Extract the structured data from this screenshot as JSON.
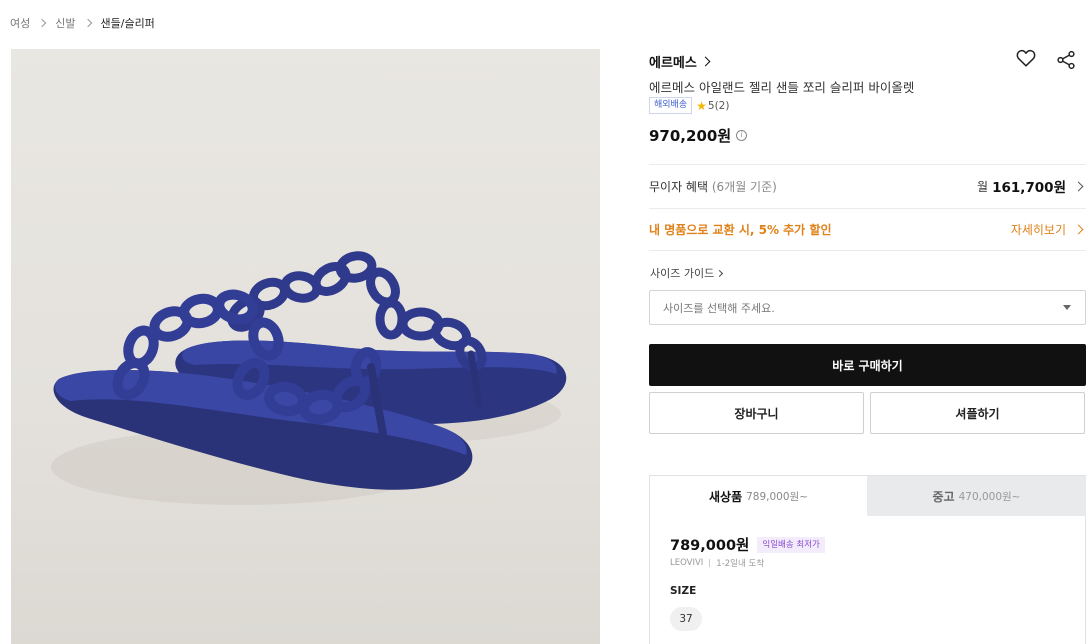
{
  "breadcrumb": {
    "items": [
      {
        "label": "여성"
      },
      {
        "label": "신발"
      },
      {
        "label": "샌들/슬리퍼"
      }
    ]
  },
  "product": {
    "image_alt": "blue rubber chain-link thong sandals",
    "brand": "에르메스",
    "name": "에르메스 아일랜드 젤리 샌들 쪼리 슬리퍼 바이올렛",
    "shipping_tag": "해외배송",
    "rating": "5(2)",
    "price": "970,200원"
  },
  "icons": {
    "like": "heart-icon",
    "share": "share-icon",
    "info": "info-icon",
    "star": "star-icon"
  },
  "installment": {
    "label": "무이자 혜택",
    "sub": "(6개월 기준)",
    "prefix": "월",
    "amount": "161,700원"
  },
  "exchange": {
    "label": "내 명품으로 교환 시, 5% 추가 할인",
    "more": "자세히보기"
  },
  "size_guide": {
    "label": "사이즈 가이드",
    "select_placeholder": "사이즈를 선택해 주세요."
  },
  "actions": {
    "buy": "바로 구매하기",
    "cart": "장바구니",
    "sample": "셔플하기"
  },
  "offers": {
    "tabs": [
      {
        "label": "새상품",
        "sub": "789,000원~"
      },
      {
        "label": "중고",
        "sub": "470,000원~"
      }
    ],
    "active": {
      "price": "789,000원",
      "badge": "익일배송 최저가",
      "seller": "LEOVIVI",
      "delivery": "1-2일내 도착",
      "size_label": "SIZE",
      "size": "37"
    }
  },
  "colors": {
    "accent_orange": "#e0821a",
    "sandal_blue": "#2f3a8c",
    "buy_button": "#111111",
    "badge_purple": "#8a4ad0"
  }
}
